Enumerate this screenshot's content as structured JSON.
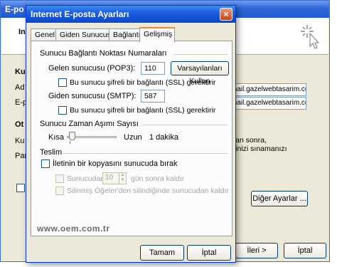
{
  "background_window": {
    "title": "E-po",
    "header_text": "In",
    "left_labels": [
      "Ku",
      "Ad",
      "E-p",
      "Ot",
      "Ku",
      "Par"
    ],
    "email_fields": [
      "mail.gazelwebtasarim.com",
      "mail.gazelwebtasarim.com"
    ],
    "info_lines": [
      "ktan sonra,",
      "ibinizi sınamanızı"
    ],
    "more_settings_button": "Diğer Ayarlar ...",
    "next_button": "İleri >",
    "cancel_button": "İptal"
  },
  "dialog": {
    "title": "Internet E-posta Ayarları",
    "close_icon": "×",
    "tabs": [
      "Genel",
      "Giden Sunucusu",
      "Bağlantı",
      "Gelişmiş"
    ],
    "active_tab": "Gelişmiş",
    "port_section": {
      "heading": "Sunucu Bağlantı Noktası Numaraları",
      "incoming_label": "Gelen sunucusu (POP3):",
      "incoming_value": "110",
      "defaults_button": "Varsayılanları Kullan",
      "incoming_ssl_label": "Bu sunucu şifreli bir bağlantı (SSL) gerektirir",
      "outgoing_label": "Giden sunucusu (SMTP):",
      "outgoing_value": "587",
      "outgoing_ssl_label": "Bu sunucu şifreli bir bağlantı (SSL) gerektirir"
    },
    "timeout_section": {
      "heading": "Sunucu Zaman Aşımı Sayısı",
      "short_label": "Kısa",
      "long_label": "Uzun",
      "value_text": "1 dakika",
      "level": 0.05
    },
    "delivery_section": {
      "heading": "Teslim",
      "leave_copy_label": "İletinin bir kopyasını sunucuda bırak",
      "remove_after_label": "Sunucudan",
      "days_value": "10",
      "days_suffix": "gün sonra kaldır",
      "remove_deleted_label": "Silinmiş Öğeler'den silindiğinde sunucudan kaldır"
    },
    "watermark": "www.oem.com.tr",
    "ok_button": "Tamam",
    "cancel_button": "İptal"
  }
}
